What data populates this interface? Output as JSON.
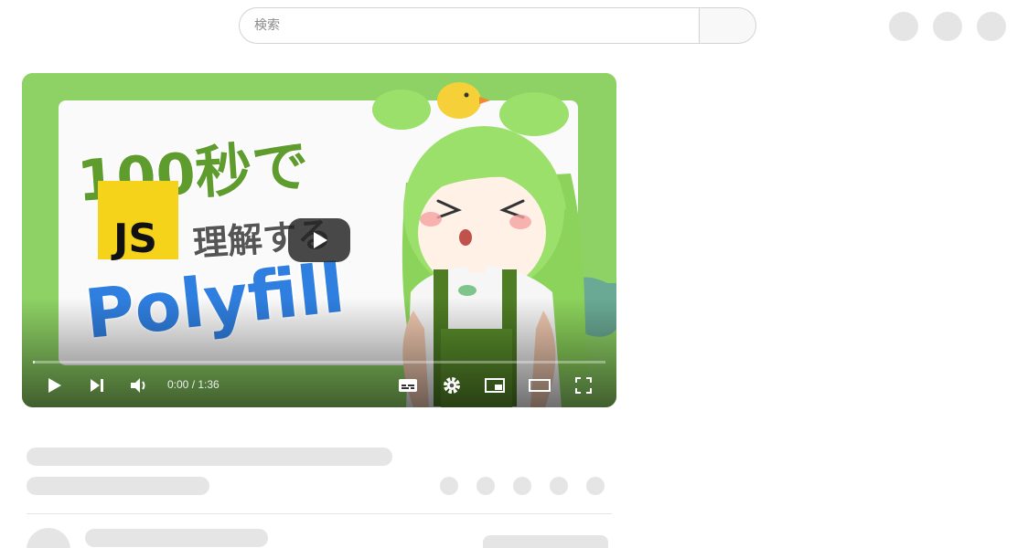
{
  "search": {
    "placeholder": "検索"
  },
  "header": {
    "icons": [
      "apps-icon",
      "notifications-icon",
      "account-icon"
    ]
  },
  "video": {
    "thumbnail_text": {
      "line1": "100秒で",
      "badge": "JS",
      "line2": "理解する",
      "line3": "Polyfill"
    },
    "time": "0:00 / 1:36",
    "progress": 0.0,
    "colors": {
      "frame_green": "#8ed265",
      "title_green": "#5e9c2e",
      "polyfill_blue": "#2f7fe0",
      "js_yellow": "#f5d31b",
      "hair_green": "#9be06a"
    }
  }
}
